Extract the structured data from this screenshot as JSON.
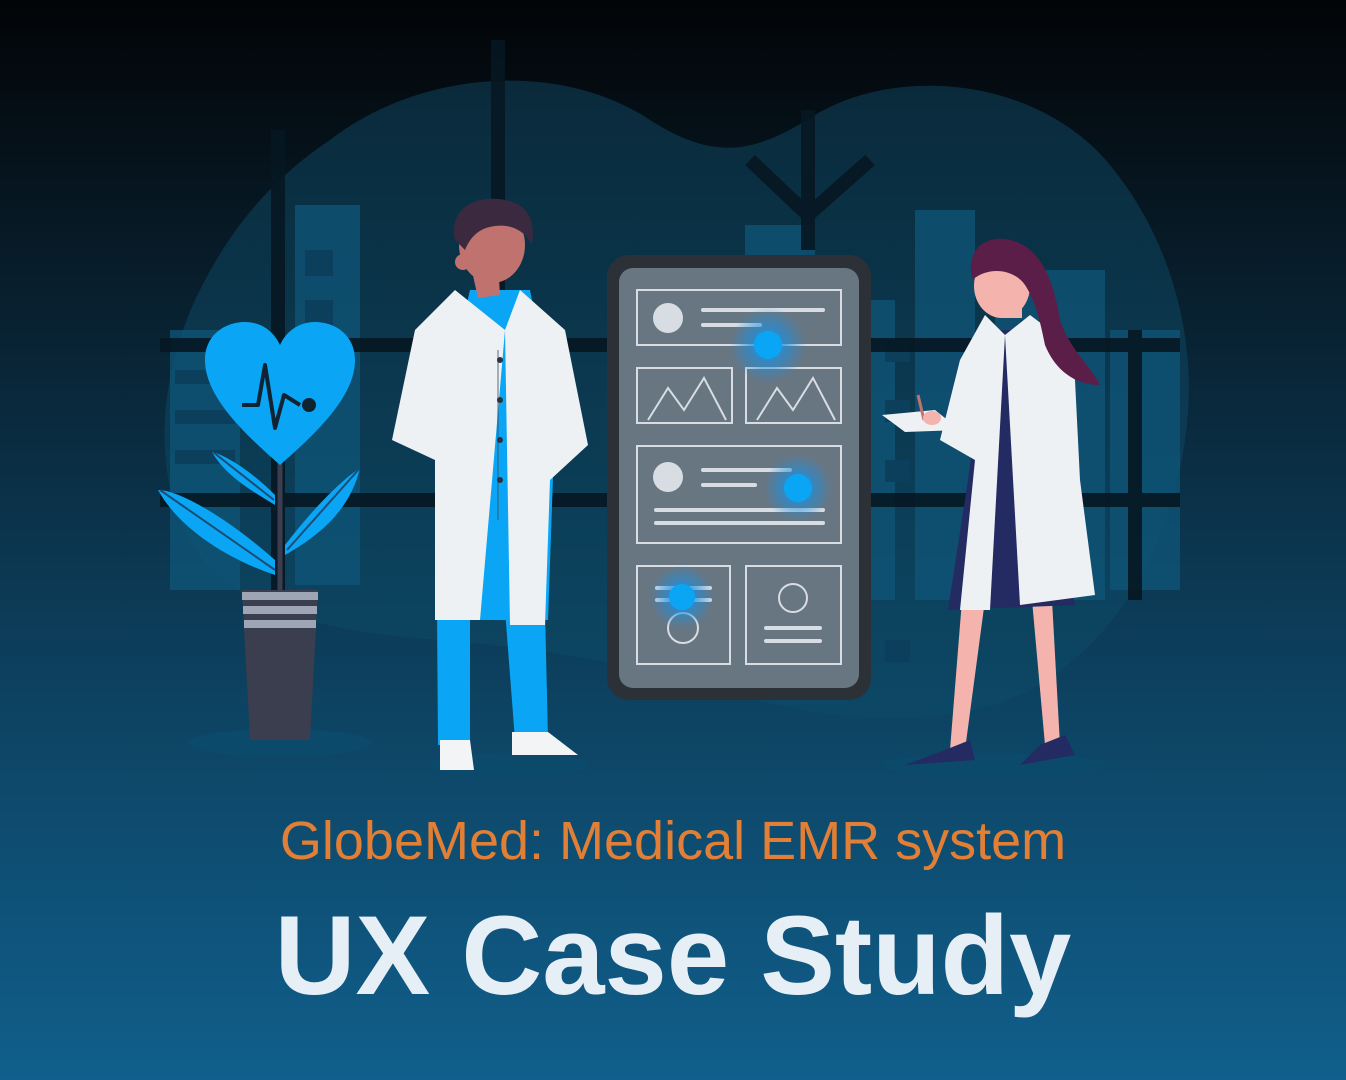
{
  "hero": {
    "subtitle": "GlobeMed: Medical EMR system",
    "title": "UX Case Study"
  },
  "colors": {
    "accent": "#e07f35",
    "title": "#e7eff6",
    "highlight": "#0aa6f5",
    "background_top": "#020406",
    "background_bottom": "#105f8c"
  },
  "illustration": {
    "icons": [
      "heart-pulse-icon",
      "plant-icon",
      "medical-screen-icon",
      "doctor-icon",
      "nurse-icon"
    ]
  }
}
